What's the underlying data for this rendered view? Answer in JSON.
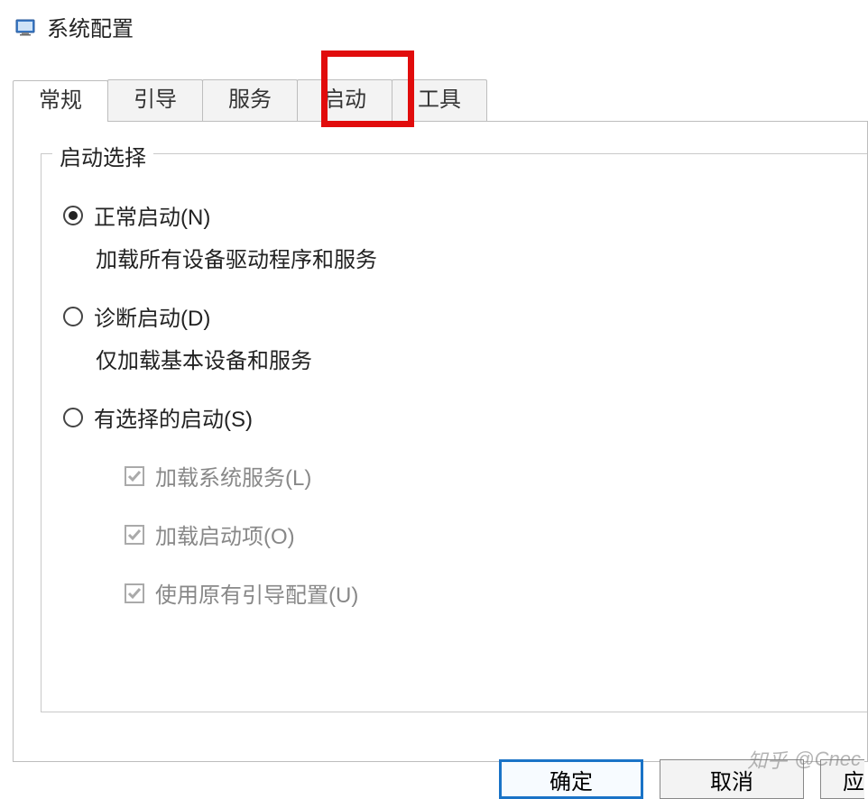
{
  "window": {
    "title": "系统配置"
  },
  "tabs": {
    "general": "常规",
    "boot": "引导",
    "services": "服务",
    "startup": "启动",
    "tools": "工具"
  },
  "group": {
    "title": "启动选择"
  },
  "radios": {
    "normal": {
      "label": "正常启动(N)",
      "desc": "加载所有设备驱动程序和服务"
    },
    "diagnostic": {
      "label": "诊断启动(D)",
      "desc": "仅加载基本设备和服务"
    },
    "selective": {
      "label": "有选择的启动(S)"
    }
  },
  "checks": {
    "services": "加载系统服务(L)",
    "startup": "加载启动项(O)",
    "bootcfg": "使用原有引导配置(U)"
  },
  "buttons": {
    "ok": "确定",
    "cancel": "取消",
    "apply": "应"
  },
  "watermark": {
    "brand": "知乎",
    "author": "@Cnec"
  }
}
